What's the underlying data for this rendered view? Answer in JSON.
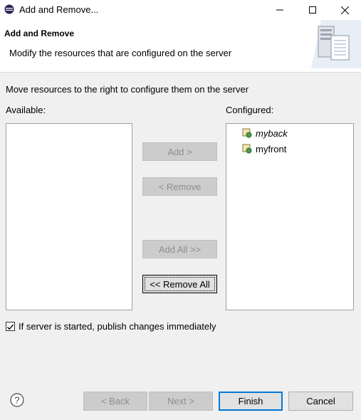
{
  "window": {
    "title": "Add and Remove..."
  },
  "header": {
    "title": "Add and Remove",
    "description": "Modify the resources that are configured on the server"
  },
  "instruction": "Move resources to the right to configure them on the server",
  "available": {
    "label": "Available:",
    "items": []
  },
  "configured": {
    "label": "Configured:",
    "items": [
      {
        "name": "myback",
        "style": "italic"
      },
      {
        "name": "myfront",
        "style": "normal"
      }
    ]
  },
  "buttons": {
    "add": "Add >",
    "remove": "< Remove",
    "add_all": "Add All >>",
    "remove_all": "<< Remove All"
  },
  "publish_checkbox": {
    "label": "If server is started, publish changes immediately",
    "checked": true
  },
  "footer": {
    "back": "< Back",
    "next": "Next >",
    "finish": "Finish",
    "cancel": "Cancel"
  },
  "colors": {
    "default_button_border": "#0078d7",
    "disabled_text": "#8d8d8d"
  }
}
